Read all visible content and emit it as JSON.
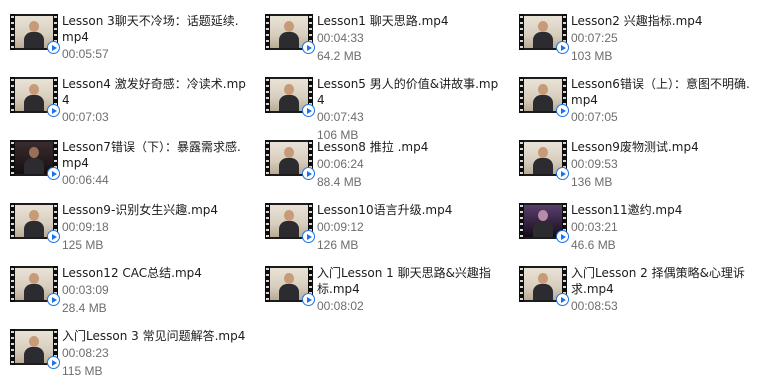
{
  "items": [
    {
      "name": "Lesson 3聊天不冷场：话题延续.mp4",
      "duration": "00:05:57",
      "size": "",
      "thumb": "light"
    },
    {
      "name": "Lesson1 聊天思路.mp4",
      "duration": "00:04:33",
      "size": "64.2 MB",
      "thumb": "light"
    },
    {
      "name": "Lesson2 兴趣指标.mp4",
      "duration": "00:07:25",
      "size": "103 MB",
      "thumb": "light"
    },
    {
      "name": "Lesson4 激发好奇感：冷读术.mp4",
      "duration": "00:07:03",
      "size": "",
      "thumb": "light"
    },
    {
      "name": "Lesson5 男人的价值&讲故事.mp4",
      "duration": "00:07:43",
      "size": "106 MB",
      "thumb": "light"
    },
    {
      "name": "Lesson6错误（上）：意图不明确.mp4",
      "duration": "00:07:05",
      "size": "",
      "thumb": "light"
    },
    {
      "name": "Lesson7错误（下）：暴露需求感.mp4",
      "duration": "00:06:44",
      "size": "",
      "thumb": "dark"
    },
    {
      "name": "Lesson8 推拉    .mp4",
      "duration": "00:06:24",
      "size": "88.4 MB",
      "thumb": "light"
    },
    {
      "name": "Lesson9废物测试.mp4",
      "duration": "00:09:53",
      "size": "136 MB",
      "thumb": "light"
    },
    {
      "name": "Lesson9-识别女生兴趣.mp4",
      "duration": "00:09:18",
      "size": "125 MB",
      "thumb": "light"
    },
    {
      "name": "Lesson10语言升级.mp4",
      "duration": "00:09:12",
      "size": "126 MB",
      "thumb": "light"
    },
    {
      "name": "Lesson11邀约.mp4",
      "duration": "00:03:21",
      "size": "46.6 MB",
      "thumb": "purple"
    },
    {
      "name": "Lesson12 CAC总结.mp4",
      "duration": "00:03:09",
      "size": "28.4 MB",
      "thumb": "light"
    },
    {
      "name": "入门Lesson 1 聊天思路&兴趣指标.mp4",
      "duration": "00:08:02",
      "size": "",
      "thumb": "light"
    },
    {
      "name": "入门Lesson 2 择偶策略&心理诉求.mp4",
      "duration": "00:08:53",
      "size": "",
      "thumb": "light"
    },
    {
      "name": "入门Lesson 3 常见问题解答.mp4",
      "duration": "00:08:23",
      "size": "115 MB",
      "thumb": "light"
    }
  ]
}
